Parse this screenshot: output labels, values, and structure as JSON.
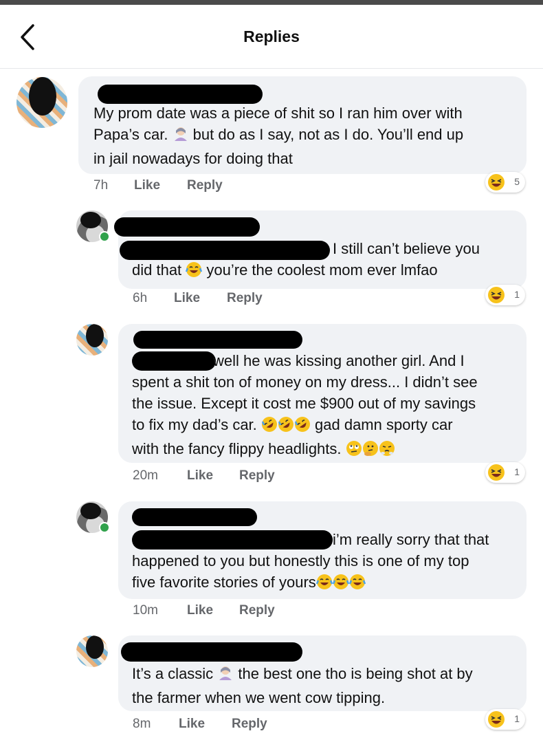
{
  "header": {
    "title": "Replies"
  },
  "comments": [
    {
      "lines": [
        "My prom date was a piece of shit so I ran him over with",
        "Papa’s car. [u] but do as I say, not as I do. You’ll end up",
        "in jail nowadays for doing that"
      ],
      "time": "7h",
      "like": "Like",
      "reply": "Reply",
      "reaction_count": "5"
    },
    {
      "lines": [
        "I still can’t believe you",
        "did that [c] you’re the coolest mom ever lmfao"
      ],
      "time": "6h",
      "like": "Like",
      "reply": "Reply",
      "reaction_count": "1"
    },
    {
      "lines": [
        "well he was kissing another girl. And I",
        "spent a shit ton of money on my dress... I didn’t see",
        "the issue. Except it cost me $900 out of my savings",
        "to fix my dad’s car. [r][r][r] gad damn sporty car",
        "with the fancy flippy headlights. [e][t][s]"
      ],
      "time": "20m",
      "like": "Like",
      "reply": "Reply",
      "reaction_count": "1"
    },
    {
      "lines": [
        "i’m really sorry that that",
        "happened to you but honestly this is one of my top",
        "five favorite stories of yours[c][c][c]"
      ],
      "time": "10m",
      "like": "Like",
      "reply": "Reply"
    },
    {
      "lines": [
        "It’s a classic [u] the best one tho is being shot at by",
        "the farmer when we went cow tipping."
      ],
      "time": "8m",
      "like": "Like",
      "reply": "Reply",
      "reaction_count": "1"
    }
  ],
  "icons": {
    "back": "chevron-left-icon",
    "reaction": "laughing-emoji-icon"
  },
  "colors": {
    "bubble": "#f0f2f5",
    "meta": "#65676b",
    "online": "#31a24c"
  }
}
